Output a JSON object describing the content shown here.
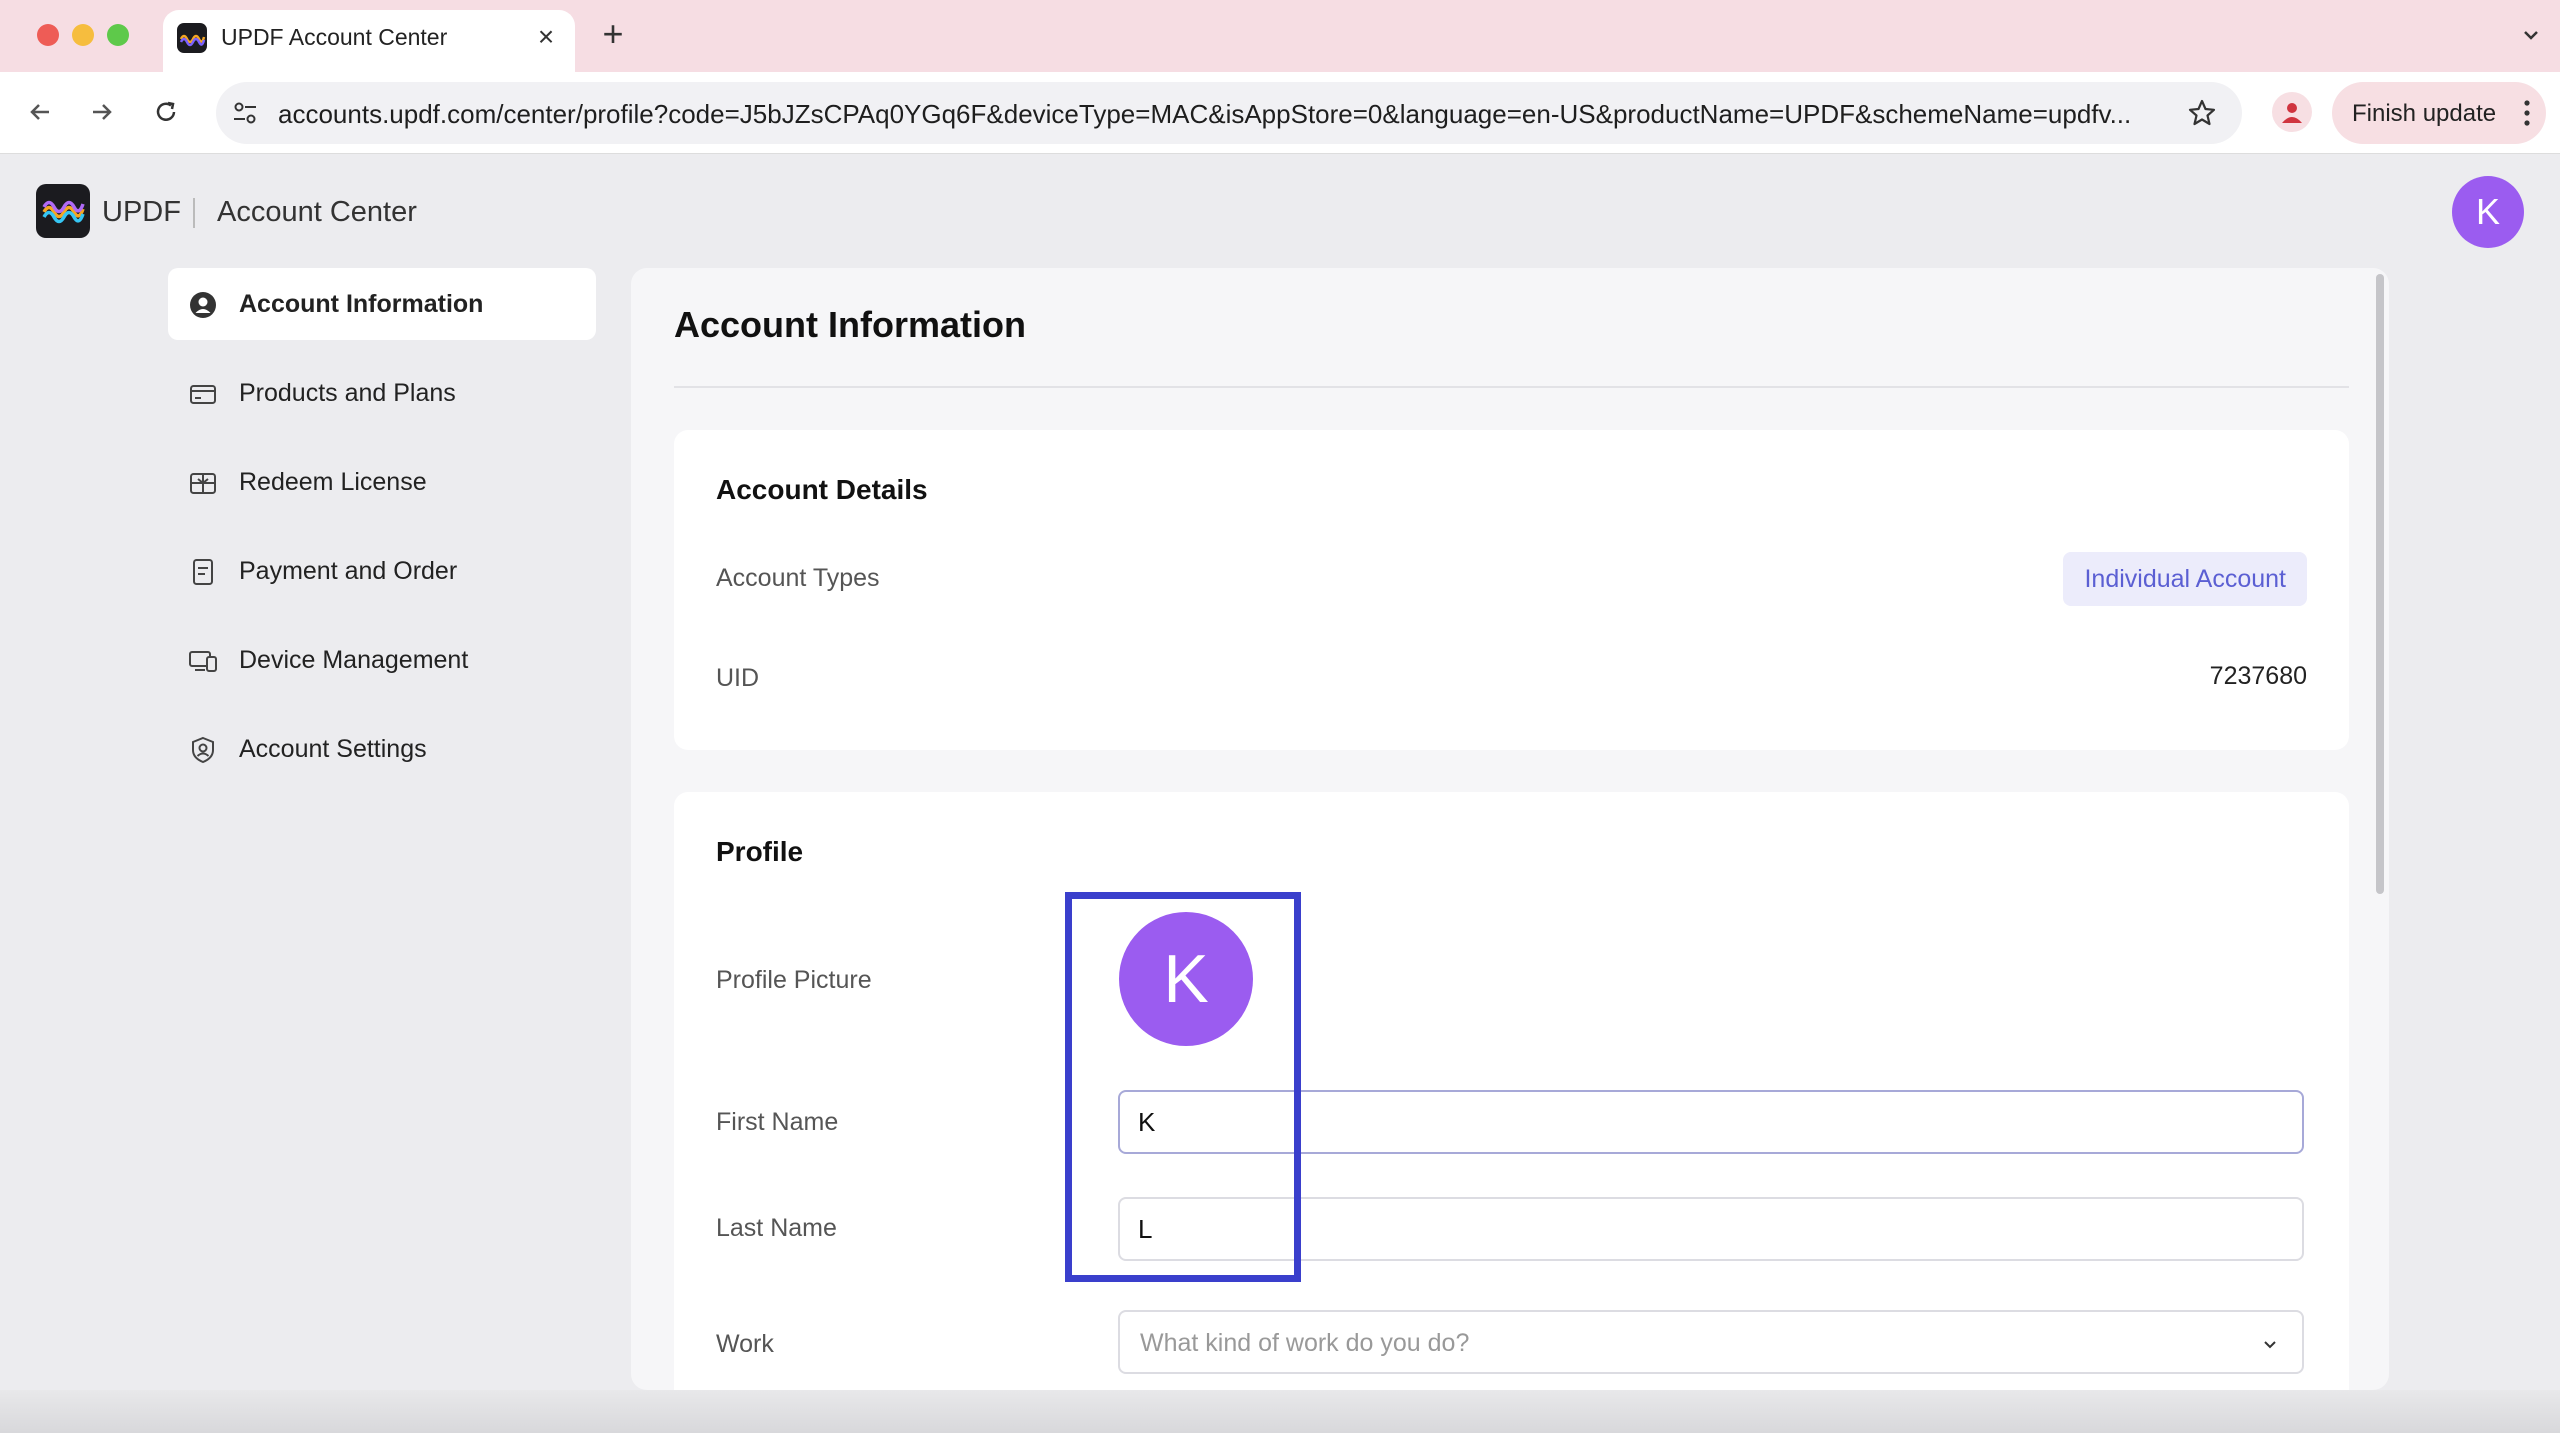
{
  "browser": {
    "tab_title": "UPDF Account Center",
    "url": "accounts.updf.com/center/profile?code=J5bJZsCPAq0YGq6F&deviceType=MAC&isAppStore=0&language=en-US&productName=UPDF&schemeName=updfv...",
    "finish_update_label": "Finish update"
  },
  "header": {
    "brand": "UPDF",
    "subtitle": "Account Center",
    "avatar_initial": "K"
  },
  "sidebar": {
    "items": [
      {
        "label": "Account Information",
        "icon": "user-circle-icon",
        "active": true
      },
      {
        "label": "Products and Plans",
        "icon": "card-icon",
        "active": false
      },
      {
        "label": "Redeem License",
        "icon": "gift-icon",
        "active": false
      },
      {
        "label": "Payment and Order",
        "icon": "receipt-icon",
        "active": false
      },
      {
        "label": "Device Management",
        "icon": "devices-icon",
        "active": false
      },
      {
        "label": "Account Settings",
        "icon": "user-settings-icon",
        "active": false
      }
    ]
  },
  "main": {
    "title": "Account Information",
    "details": {
      "title": "Account Details",
      "account_types_label": "Account Types",
      "account_type_value": "Individual Account",
      "uid_label": "UID",
      "uid_value": "7237680"
    },
    "profile": {
      "title": "Profile",
      "picture_label": "Profile Picture",
      "avatar_initial": "K",
      "first_name_label": "First Name",
      "first_name_value": "K",
      "last_name_label": "Last Name",
      "last_name_value": "L",
      "work_label": "Work",
      "work_placeholder": "What kind of work do you do?"
    }
  },
  "colors": {
    "accent": "#9b5cf0",
    "highlight": "#3a3fcc",
    "badge_text": "#5b5fd3",
    "tabstrip": "#f6dde3"
  }
}
